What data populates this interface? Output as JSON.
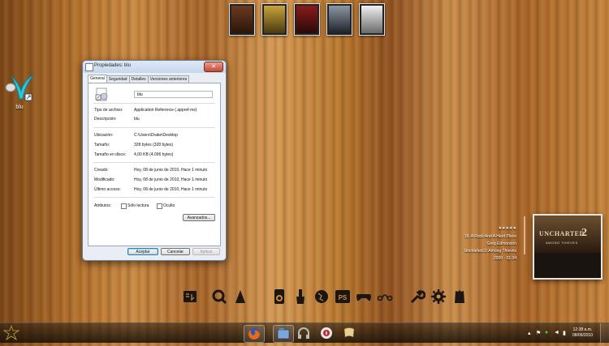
{
  "desktop": {
    "icon_label": "blu"
  },
  "top_games": [
    "game-1",
    "game-2",
    "game-3",
    "game-4",
    "game-5"
  ],
  "dialog": {
    "title": "Propiedades: blu",
    "close_label": "✕",
    "tabs": [
      "General",
      "Seguridad",
      "Detalles",
      "Versiones anteriores"
    ],
    "name_value": "blu",
    "rows": {
      "tipo_label": "Tipo de archivo:",
      "tipo_value": "Application Reference (.appref-ms)",
      "desc_label": "Descripción:",
      "desc_value": "blu",
      "ubic_label": "Ubicación:",
      "ubic_value": "C:\\Users\\Drake\\Desktop",
      "tam_label": "Tamaño:",
      "tam_value": "328 bytes (328 bytes)",
      "tamdisco_label": "Tamaño en disco:",
      "tamdisco_value": "4,00 KB (4.096 bytes)",
      "creado_label": "Creado:",
      "creado_value": "Hoy, 08 de junio de 2010, Hace 1 minuto",
      "mod_label": "Modificado:",
      "mod_value": "Hoy, 08 de junio de 2010, Hace 1 minuto",
      "acc_label": "Último acceso:",
      "acc_value": "Hoy, 08 de junio de 2010, Hace 1 minuto",
      "attr_label": "Atributos:",
      "readonly_label": "Sólo lectura",
      "hidden_label": "Oculto"
    },
    "advanced_button": "Avanzados...",
    "ok_button": "Aceptar",
    "cancel_button": "Cancelar",
    "apply_button": "Aplicar"
  },
  "music": {
    "rating": "★★★★★",
    "track": "19. A Rock And A Hard Place",
    "artist": "Greg Edmonson",
    "album": "Uncharted 2: Among Thieves",
    "year_time": "2009 · 01:34",
    "cover_title": "UNCHARTED",
    "cover_number": "2",
    "cover_subtitle": "AMONG THIEVES"
  },
  "dock_icons": [
    "notes-icon",
    "search-icon",
    "vlc-icon",
    "speaker-icon",
    "paint-brush-icon",
    "globe-icon",
    "photoshop-icon",
    "gamepad-icon",
    "network-icon",
    "wrench-icon",
    "gear-icon",
    "recycle-bin-icon"
  ],
  "dock_ps_label": "PS",
  "taskbar": {
    "time": "12:38 a.m.",
    "date": "08/06/2010"
  },
  "colors": {
    "wood_light": "#c98a44",
    "wood_dark": "#7a4516",
    "dialog_bg": "#e9eef5",
    "close_red": "#c44a33"
  }
}
